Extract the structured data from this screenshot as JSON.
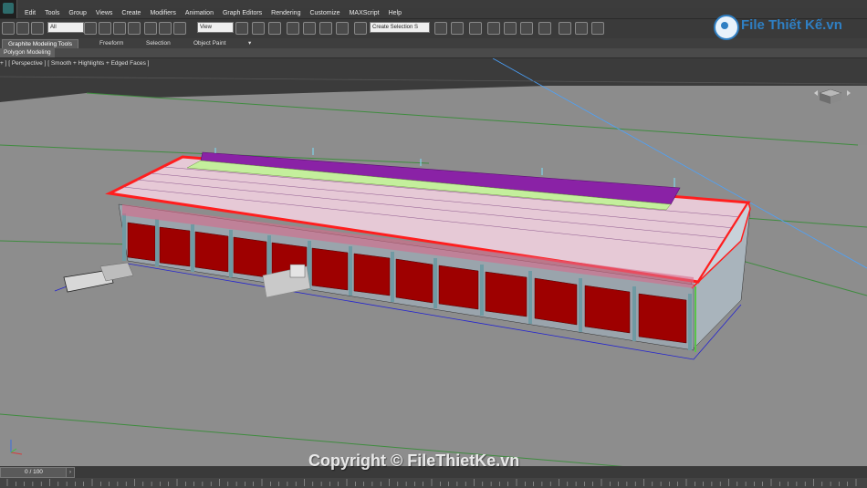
{
  "menu": [
    "Edit",
    "Tools",
    "Group",
    "Views",
    "Create",
    "Modifiers",
    "Animation",
    "Graph Editors",
    "Rendering",
    "Customize",
    "MAXScript",
    "Help"
  ],
  "toolbar": {
    "filter_value": "All",
    "view_value": "View",
    "selection_set_placeholder": "Create Selection S"
  },
  "ribbon_tabs": [
    "Graphite Modeling Tools",
    "Freeform",
    "Selection",
    "Object Paint"
  ],
  "ribbon_extra": "▾",
  "subbar_label": "Polygon Modeling",
  "viewport_label": "+ ] [ Perspective ] [ Smooth + Highlights + Edged Faces ]",
  "watermark": "Copyright © FileThietKe.vn",
  "logo_text": "File Thiết Kế.vn",
  "timeline": {
    "frame": "0 / 100"
  },
  "colors": {
    "viewport_bg": "#8c8c8c",
    "roof_outline": "#ff1e1e",
    "door": "#9e0000",
    "grid": "#3f8c3f",
    "ridge": "#8a22a6"
  }
}
